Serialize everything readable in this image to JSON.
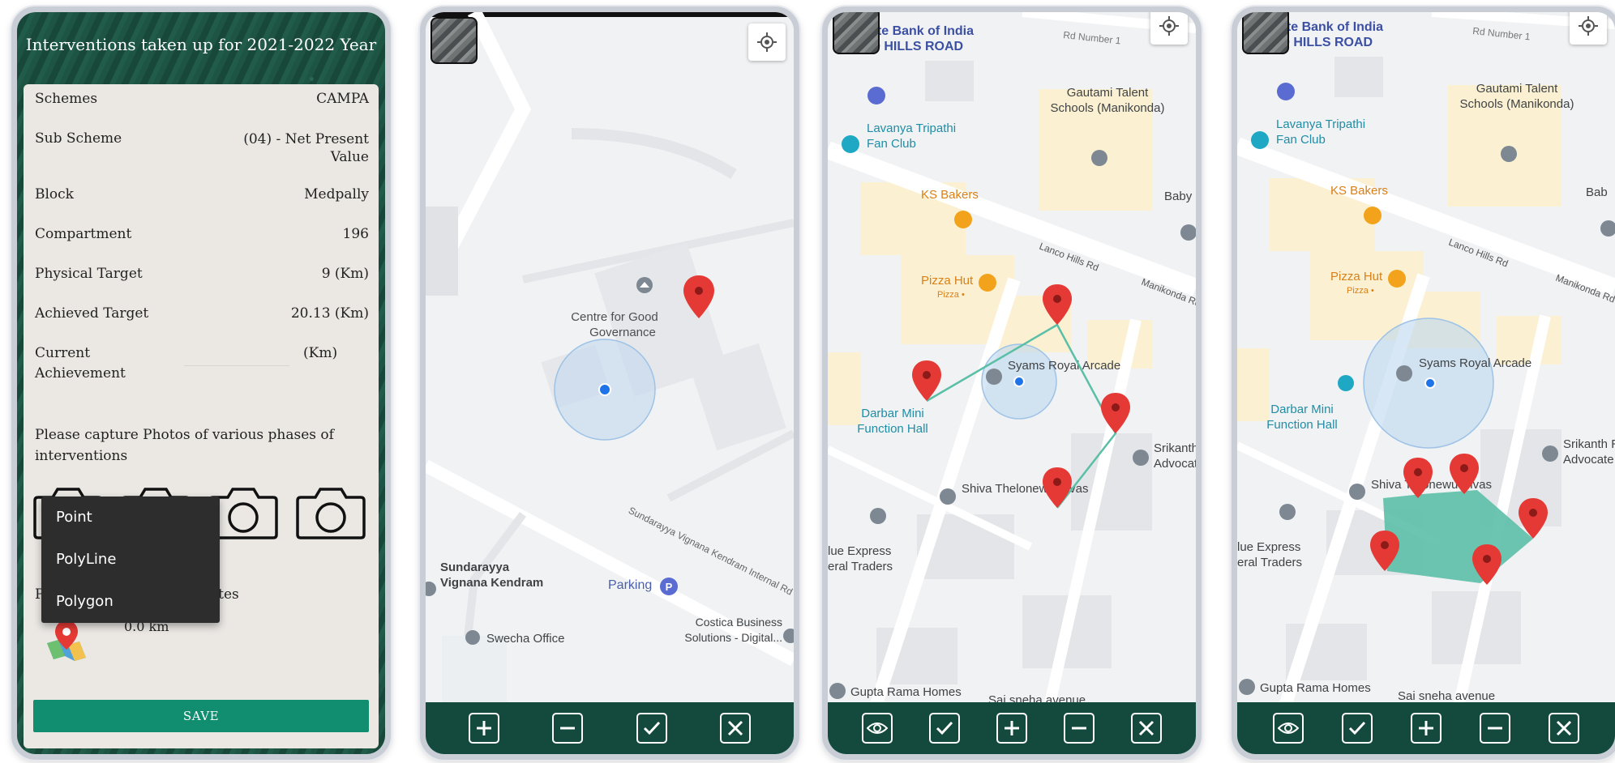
{
  "form": {
    "header": "Interventions taken up for 2021-2022 Year",
    "rows": [
      {
        "label": "Schemes",
        "value": "CAMPA"
      },
      {
        "label": "Sub Scheme",
        "value": "(04) - Net Present Value"
      },
      {
        "label": "Block",
        "value": "Medpally"
      },
      {
        "label": "Compartment",
        "value": "196"
      },
      {
        "label": "Physical Target",
        "value": "9 (Km)"
      },
      {
        "label": "Achieved Target",
        "value": "20.13 (Km)"
      }
    ],
    "current_achievement_label_1": "Current",
    "current_achievement_label_2": "Achievement",
    "current_achievement_unit": "(Km)",
    "capture_text": "Please capture Photos of various phases of interventions",
    "coords_label_start": "P",
    "coords_label_end": "ates",
    "distance": "0.0 km",
    "save_label": "SAVE",
    "dropdown_options": [
      "Point",
      "PolyLine",
      "Polygon"
    ]
  },
  "map2": {
    "labels": {
      "centre1": "Centre for Good",
      "centre2": "Governance",
      "street": "Sundarayya Vignana Kendram Internal Rd",
      "sundarayya1": "Sundarayya",
      "sundarayya2": "Vignana Kendram",
      "parking": "Parking",
      "swecha": "Swecha Office",
      "costica1": "Costica Business",
      "costica2": "Solutions - Digital..."
    }
  },
  "map3": {
    "labels": {
      "bank1": "ate Bank of India",
      "bank2": "LANCO HILLS ROAD",
      "rd1": "Rd Number 1",
      "gautami1": "Gautami Talent",
      "gautami2": "Schools (Manikonda)",
      "lavanya1": "Lavanya Tripathi",
      "lavanya2": "Fan Club",
      "ksbakers": "KS Bakers",
      "baby": "Baby",
      "lanco": "Lanco Hills Rd",
      "pizzahut": "Pizza Hut",
      "pizza": "Pizza •",
      "manikonda": "Manikonda Rd",
      "syams": "Syams Royal Arcade",
      "darbar1": "Darbar Mini",
      "darbar2": "Function Hall",
      "srikanth1": "Srikanth R",
      "srikanth2": "Advocate S",
      "shiva": "Shiva Thelonewu   Nivas",
      "blue1": "lue Express",
      "blue2": "eral Traders",
      "gupta": "Gupta Rama Homes",
      "sai": "Sai sneha avenue"
    }
  },
  "map4": {
    "labels": {
      "bank1": "ate Bank of India",
      "bank2": "LANCO HILLS ROAD",
      "rd1": "Rd Number 1",
      "gautami1": "Gautami Talent",
      "gautami2": "Schools (Manikonda)",
      "lavanya1": "Lavanya Tripathi",
      "lavanya2": "Fan Club",
      "ksbakers": "KS Bakers",
      "baby": "Bab",
      "lanco": "Lanco Hills Rd",
      "pizzahut": "Pizza Hut",
      "pizza": "Pizza •",
      "manikonda": "Manikonda Rd",
      "syams": "Syams Royal Arcade",
      "darbar1": "Darbar Mini",
      "darbar2": "Function Hall",
      "srikanth1": "Srikanth R",
      "srikanth2": "Advocate S",
      "shiva": "Shiva Th    onewu   Nivas",
      "blue1": "lue Express",
      "blue2": "eral Traders",
      "gupta": "Gupta Rama Homes",
      "sai": "Sai sneha avenue"
    }
  },
  "colors": {
    "toolbar": "#134a3d",
    "save": "#118d6f",
    "polygon_fill": "#5bbfa7",
    "marker": "#e53935"
  },
  "icons": [
    "plus-icon",
    "minus-icon",
    "check-icon",
    "close-icon",
    "eye-icon",
    "camera-icon",
    "location-target-icon",
    "map-pin-icon",
    "map-marker-icon"
  ]
}
